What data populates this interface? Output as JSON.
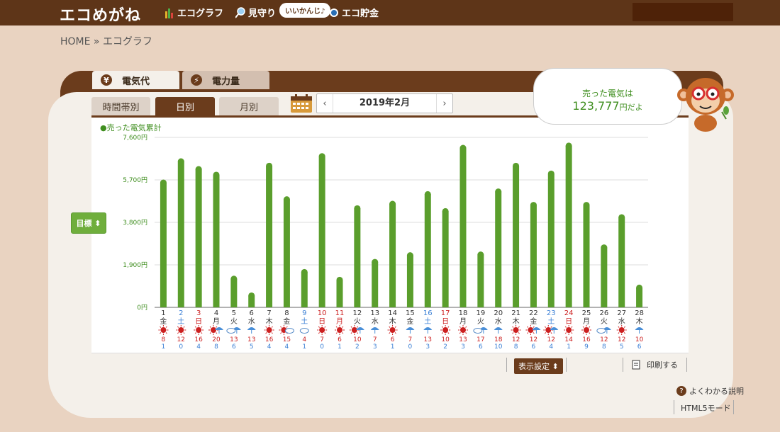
{
  "header": {
    "logo": "エコめがね",
    "nav": [
      {
        "label": "エコグラフ",
        "icon": "bar-chart-icon"
      },
      {
        "label": "見守り",
        "icon": "magnifier-icon"
      },
      {
        "label": "エコ貯金",
        "icon": "coin-icon"
      }
    ],
    "bubble": "いいかんじ♪"
  },
  "breadcrumb": "HOME » エコグラフ",
  "tabs": [
    {
      "label": "電気代",
      "icon": "yen-icon",
      "glyph": "¥",
      "active": true
    },
    {
      "label": "電力量",
      "icon": "bolt-icon",
      "glyph": "⚡",
      "active": false
    }
  ],
  "subtabs": [
    {
      "label": "時間帯別",
      "active": false
    },
    {
      "label": "日別",
      "active": true
    },
    {
      "label": "月別",
      "active": false
    }
  ],
  "month_nav": {
    "prev": "‹",
    "label": "2019年2月",
    "next": "›"
  },
  "legend": "●売った電気累計",
  "target_button": "目標 ⬍",
  "summary": {
    "line1": "売った電気は",
    "amount": "123,777",
    "suffix": "円だよ"
  },
  "controls": {
    "display": "表示設定 ⬍",
    "print": "印刷する",
    "help": "よくわかる説明",
    "html5": "HTML5モード"
  },
  "colors": {
    "bar": "#5a9e2c",
    "brown": "#6b3c1c",
    "sun": "#cc2020",
    "rain": "#4a8fd8",
    "blue_day": "#3a7fd5",
    "red_day": "#cc2020"
  },
  "chart_data": {
    "type": "bar",
    "ylim": [
      0,
      7600
    ],
    "yticks": [
      "0円",
      "1,900円",
      "3,800円",
      "5,700円",
      "7,600円"
    ],
    "categories": [
      "1",
      "2",
      "3",
      "4",
      "5",
      "6",
      "7",
      "8",
      "9",
      "10",
      "11",
      "12",
      "13",
      "14",
      "15",
      "16",
      "17",
      "18",
      "19",
      "20",
      "21",
      "22",
      "23",
      "24",
      "25",
      "26",
      "27",
      "28"
    ],
    "weekdays": [
      "金",
      "土",
      "日",
      "月",
      "火",
      "水",
      "木",
      "金",
      "土",
      "日",
      "月",
      "火",
      "水",
      "木",
      "金",
      "土",
      "日",
      "月",
      "火",
      "水",
      "木",
      "金",
      "土",
      "日",
      "月",
      "火",
      "水",
      "木"
    ],
    "day_colors": [
      "#333",
      "#3a7fd5",
      "#cc2020",
      "#333",
      "#333",
      "#333",
      "#333",
      "#333",
      "#3a7fd5",
      "#cc2020",
      "#cc2020",
      "#333",
      "#333",
      "#333",
      "#333",
      "#3a7fd5",
      "#cc2020",
      "#333",
      "#333",
      "#333",
      "#333",
      "#333",
      "#3a7fd5",
      "#cc2020",
      "#333",
      "#333",
      "#333",
      "#333"
    ],
    "values": [
      5700,
      6650,
      6300,
      6050,
      1400,
      650,
      6450,
      4950,
      1700,
      6880,
      1350,
      4550,
      2150,
      4750,
      2450,
      5180,
      4420,
      7250,
      2480,
      5300,
      6450,
      4700,
      6100,
      7350,
      4700,
      2800,
      4150,
      1000
    ],
    "weather": [
      "sun",
      "sun",
      "sun",
      "sun-rain",
      "cloud-rain",
      "rain",
      "sun",
      "sun-cloud",
      "cloud",
      "sun",
      "sun",
      "sun-rain",
      "rain",
      "sun",
      "rain",
      "rain",
      "sun",
      "sun",
      "cloud-rain",
      "rain",
      "sun",
      "sun-rain",
      "sun-rain",
      "sun",
      "sun",
      "cloud-rain",
      "sun",
      "rain"
    ],
    "high": [
      8,
      12,
      16,
      20,
      13,
      13,
      16,
      15,
      4,
      7,
      6,
      10,
      7,
      6,
      7,
      13,
      10,
      13,
      17,
      18,
      12,
      12,
      12,
      14,
      16,
      12,
      12,
      10
    ],
    "low": [
      1,
      0,
      4,
      8,
      6,
      5,
      4,
      4,
      1,
      0,
      1,
      2,
      3,
      1,
      0,
      3,
      2,
      3,
      6,
      10,
      8,
      6,
      4,
      1,
      9,
      8,
      5,
      6
    ],
    "title": "",
    "xlabel": "",
    "ylabel": ""
  }
}
